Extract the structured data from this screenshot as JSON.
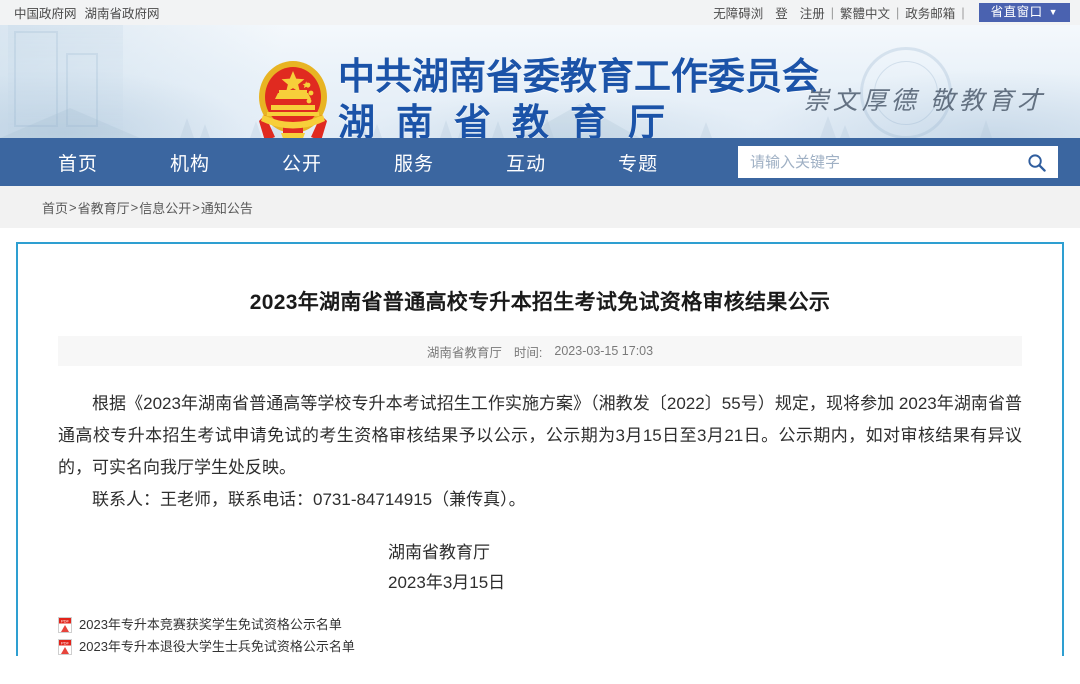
{
  "topbar": {
    "left_links": [
      "中国政府网",
      "湖南省政府网"
    ],
    "right_links": [
      "无障碍浏",
      "登",
      "注册",
      "繁體中文",
      "政务邮箱"
    ],
    "province_button": "省直窗口",
    "caret": "▼"
  },
  "banner": {
    "title_line1": "中共湖南省委教育工作委员会",
    "title_line2": "湖南省教育厅",
    "slogan": "崇文厚德  敬教育才",
    "emblem_icon": "national-emblem-icon",
    "brand_color": "#1b53a8"
  },
  "nav": {
    "items": [
      "首页",
      "机构",
      "公开",
      "服务",
      "互动",
      "专题"
    ],
    "bar_color": "#3b66a0",
    "search": {
      "placeholder": "请输入关键字",
      "value": "",
      "icon": "search-icon"
    }
  },
  "breadcrumb": {
    "items": [
      "首页",
      "省教育厅",
      "信息公开",
      "通知公告"
    ],
    "separator": ">"
  },
  "article": {
    "title": "2023年湖南省普通高校专升本招生考试免试资格审核结果公示",
    "source": "湖南省教育厅",
    "time_label": "时间:",
    "time": "2023-03-15 17:03",
    "paragraphs": [
      "根据《2023年湖南省普通高等学校专升本考试招生工作实施方案》（湘教发〔2022〕55号）规定，现将参加 2023年湖南省普通高校专升本招生考试申请免试的考生资格审核结果予以公示，公示期为3月15日至3月21日。公示期内，如对审核结果有异议的，可实名向我厅学生处反映。",
      "联系人：王老师，联系电话：0731-84714915（兼传真）。"
    ],
    "signature_org": "湖南省教育厅",
    "signature_date": "2023年3月15日",
    "attachments": [
      {
        "icon": "pdf-file-icon",
        "label": "2023年专升本竞赛获奖学生免试资格公示名单"
      },
      {
        "icon": "pdf-file-icon",
        "label": "2023年专升本退役大学生士兵免试资格公示名单"
      }
    ],
    "border_color": "#2e9fd1"
  }
}
